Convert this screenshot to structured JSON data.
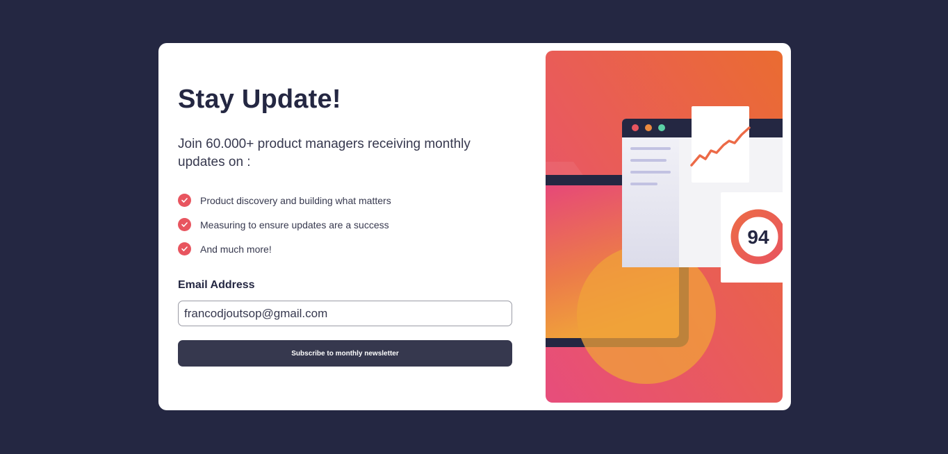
{
  "signup": {
    "title": "Stay Update!",
    "intro": "Join 60.000+ product managers receiving monthly updates on :",
    "features": [
      "Product discovery and building what matters",
      "Measuring to ensure updates are a success",
      "And much more!"
    ],
    "email_label": "Email Address",
    "email_value": "francodjoutsop@gmail.com",
    "subscribe_label": "Subscribe to monthly newsletter"
  },
  "illustration": {
    "score": "94",
    "icon": "dashboard-illustration"
  },
  "colors": {
    "background": "#242742",
    "card": "#ffffff",
    "accent": "#e8555f",
    "text_dark": "#242742",
    "text_body": "#36384e",
    "button": "#36384e"
  }
}
